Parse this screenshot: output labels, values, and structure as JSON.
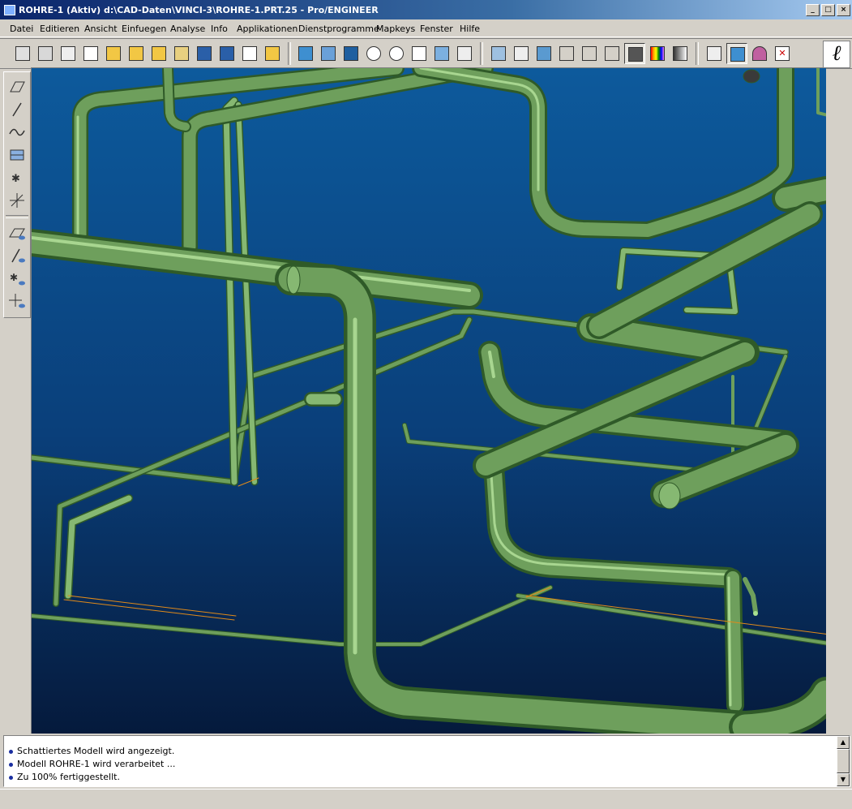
{
  "window": {
    "title": "ROHRE-1 (Aktiv)  d:\\CAD-Daten\\VINCI-3\\ROHRE-1.PRT.25 - Pro/ENGINEER",
    "minimize": "_",
    "maximize": "□",
    "close": "×"
  },
  "menu": [
    {
      "label": "Datei"
    },
    {
      "label": "Editieren"
    },
    {
      "label": "Ansicht"
    },
    {
      "label": "Einfuegen"
    },
    {
      "label": "Analyse"
    },
    {
      "label": "Info"
    },
    {
      "label": "Applikationen"
    },
    {
      "label": "Dienstprogramme"
    },
    {
      "label": "Mapkeys"
    },
    {
      "label": "Fenster"
    },
    {
      "label": "Hilfe"
    }
  ],
  "toolbar": [
    {
      "icon": "print-icon"
    },
    {
      "icon": "print-preview-icon"
    },
    {
      "icon": "plot-icon"
    },
    {
      "icon": "pdf-export-icon"
    },
    {
      "icon": "open-model-icon"
    },
    {
      "icon": "open-folder-icon"
    },
    {
      "icon": "open-recent-icon"
    },
    {
      "icon": "open-session-icon"
    },
    {
      "icon": "save-icon"
    },
    {
      "icon": "save-copy-icon"
    },
    {
      "icon": "new-file-icon"
    },
    {
      "icon": "open-file-icon"
    },
    {
      "icon": "regenerate-icon"
    },
    {
      "icon": "redraw-icon"
    },
    {
      "icon": "spin-center-icon"
    },
    {
      "icon": "zoom-in-icon"
    },
    {
      "icon": "zoom-out-icon"
    },
    {
      "icon": "refit-icon"
    },
    {
      "icon": "named-views-icon"
    },
    {
      "icon": "model-tree-icon"
    },
    {
      "icon": "layers-icon"
    },
    {
      "icon": "dimension-icon"
    },
    {
      "icon": "orient-icon"
    },
    {
      "icon": "wireframe-icon"
    },
    {
      "icon": "hidden-line-icon"
    },
    {
      "icon": "no-hidden-icon"
    },
    {
      "icon": "shading-icon",
      "pressed": true
    },
    {
      "icon": "color-palette-icon"
    },
    {
      "icon": "gradient-icon"
    },
    {
      "icon": "datum-axes-icon"
    },
    {
      "icon": "select-datum-icon",
      "pressed": true
    },
    {
      "icon": "spin-icon"
    },
    {
      "icon": "close-window-icon"
    }
  ],
  "palette": [
    {
      "icon": "datum-plane-icon"
    },
    {
      "icon": "datum-axis-icon"
    },
    {
      "icon": "datum-curve-icon"
    },
    {
      "icon": "datum-point-array-icon"
    },
    {
      "icon": "datum-point-icon"
    },
    {
      "icon": "coordinate-system-icon"
    },
    {
      "icon": "plane-display-icon"
    },
    {
      "icon": "axis-display-icon"
    },
    {
      "icon": "point-display-icon"
    },
    {
      "icon": "csys-display-icon"
    }
  ],
  "messages": [
    {
      "text": "Schattiertes Modell wird angezeigt."
    },
    {
      "text": "Modell ROHRE-1 wird verarbeitet ..."
    },
    {
      "text": "Zu 100% fertiggestellt."
    }
  ],
  "colors": {
    "pipe": "#5e8f4e",
    "pipe_highlight": "#9dcf86",
    "pipe_shadow": "#2f5a28",
    "viewport_top": "#0d5a9c",
    "viewport_bottom": "#051a3c"
  }
}
